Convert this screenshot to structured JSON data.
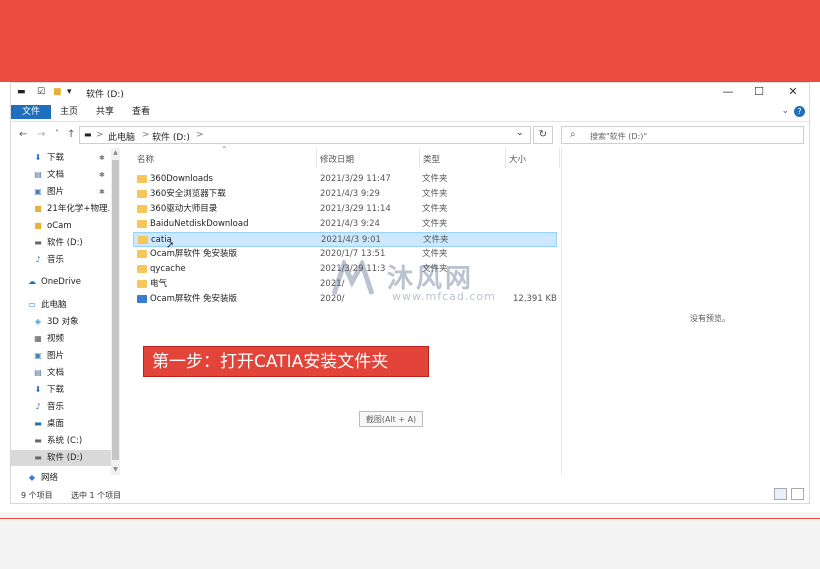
{
  "colors": {
    "accent": "#1f6fbf",
    "banner": "#e94b3c",
    "callout": "#e3443a",
    "folder": "#f5c75b",
    "selection": "#cce8ff"
  },
  "window": {
    "title": "软件 (D:)",
    "controls": {
      "minimize": "—",
      "maximize": "☐",
      "close": "✕"
    }
  },
  "ribbon": {
    "tabs": [
      "文件",
      "主页",
      "共享",
      "查看"
    ],
    "help": "?"
  },
  "address": {
    "back": "←",
    "forward": "→",
    "recent": "˅",
    "up": "↑",
    "crumbs": [
      "此电脑",
      "软件 (D:)"
    ],
    "sep": ">",
    "dropdown": "⌄",
    "refresh": "↻",
    "search_placeholder": "搜索\"软件 (D:)\""
  },
  "sidebar": {
    "items": [
      {
        "label": "下载",
        "icon": "download-icon",
        "pinned": true
      },
      {
        "label": "文档",
        "icon": "document-icon",
        "pinned": true
      },
      {
        "label": "图片",
        "icon": "picture-icon",
        "pinned": true
      },
      {
        "label": "21年化学+物理...",
        "icon": "folder-icon",
        "pinned": false
      },
      {
        "label": "oCam",
        "icon": "folder-icon",
        "pinned": false
      },
      {
        "label": "软件 (D:)",
        "icon": "drive-icon",
        "pinned": false
      },
      {
        "label": "音乐",
        "icon": "music-icon",
        "pinned": false
      },
      {
        "label": "OneDrive",
        "icon": "cloud-icon",
        "pinned": false
      },
      {
        "label": "此电脑",
        "icon": "computer-icon",
        "pinned": false
      },
      {
        "label": "3D 对象",
        "icon": "cube-icon",
        "pinned": false
      },
      {
        "label": "视频",
        "icon": "video-icon",
        "pinned": false
      },
      {
        "label": "图片",
        "icon": "picture-icon",
        "pinned": false
      },
      {
        "label": "文档",
        "icon": "document-icon",
        "pinned": false
      },
      {
        "label": "下载",
        "icon": "download-icon",
        "pinned": false
      },
      {
        "label": "音乐",
        "icon": "music-icon",
        "pinned": false
      },
      {
        "label": "桌面",
        "icon": "desktop-icon",
        "pinned": false
      },
      {
        "label": "系统 (C:)",
        "icon": "drive-icon",
        "pinned": false
      },
      {
        "label": "软件 (D:)",
        "icon": "drive-icon",
        "pinned": false,
        "selected": true
      }
    ],
    "network": "网络"
  },
  "columns": {
    "name": "名称",
    "modified": "修改日期",
    "type": "类型",
    "size": "大小"
  },
  "files": [
    {
      "name": "360Downloads",
      "date": "2021/3/29 11:47",
      "type": "文件夹",
      "size": ""
    },
    {
      "name": "360安全浏览器下载",
      "date": "2021/4/3 9:29",
      "type": "文件夹",
      "size": ""
    },
    {
      "name": "360驱动大师目录",
      "date": "2021/3/29 11:14",
      "type": "文件夹",
      "size": ""
    },
    {
      "name": "BaiduNetdiskDownload",
      "date": "2021/4/3 9:24",
      "type": "文件夹",
      "size": ""
    },
    {
      "name": "catia",
      "date": "2021/4/3 9:01",
      "type": "文件夹",
      "size": "",
      "selected": true
    },
    {
      "name": "Ocam屏软件 免安装版",
      "date": "2020/1/7 13:51",
      "type": "文件夹",
      "size": ""
    },
    {
      "name": "qycache",
      "date": "2021/3/29 11:3",
      "type": "文件夹",
      "size": ""
    },
    {
      "name": "电气",
      "date": "2021/",
      "type": "",
      "size": ""
    },
    {
      "name": "Ocam屏软件 免安装版",
      "date": "2020/",
      "type": "",
      "size": "12,391 KB",
      "app": true
    }
  ],
  "preview": {
    "empty_text": "没有预览。"
  },
  "status": {
    "count": "9 个项目",
    "selected": "选中 1 个项目"
  },
  "callout": "第一步：打开CATIA安装文件夹",
  "tooltip": "截图(Alt + A)",
  "watermark": {
    "brand": "沐风网",
    "url": "www.mfcad.com"
  }
}
